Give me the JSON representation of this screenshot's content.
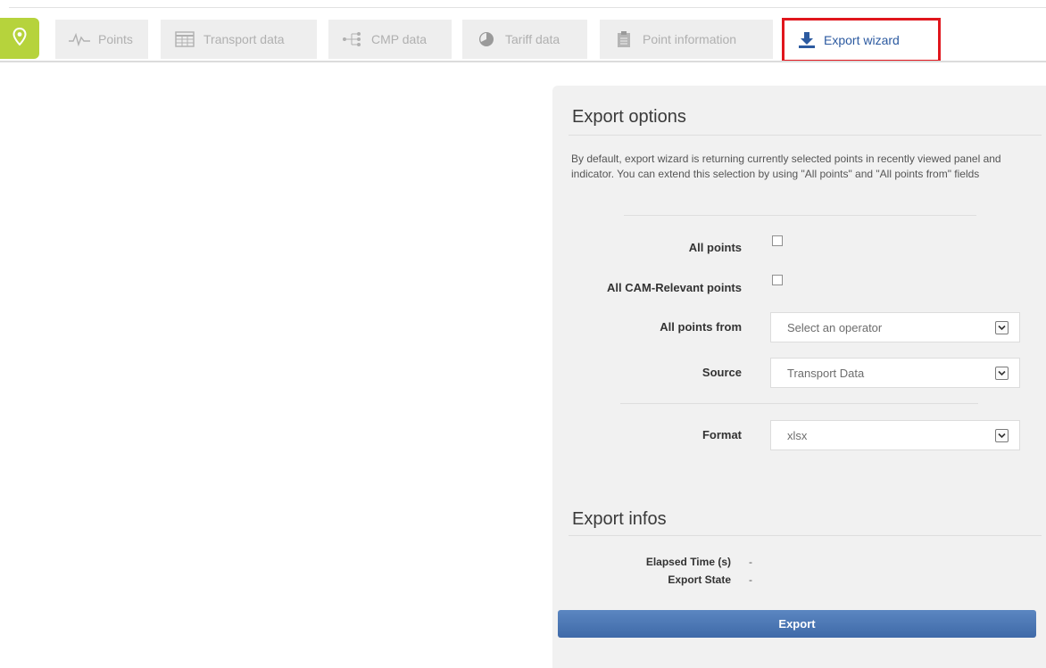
{
  "tabs": [
    {
      "name": "points",
      "label": "Points",
      "icon": "pulse-icon",
      "active": false
    },
    {
      "name": "transport-data",
      "label": "Transport data",
      "icon": "table-icon",
      "active": false
    },
    {
      "name": "cmp-data",
      "label": "CMP data",
      "icon": "network-icon",
      "active": false
    },
    {
      "name": "tariff-data",
      "label": "Tariff data",
      "icon": "pie-icon",
      "active": false
    },
    {
      "name": "point-information",
      "label": "Point information",
      "icon": "clipboard-icon",
      "active": false
    },
    {
      "name": "export-wizard",
      "label": "Export wizard",
      "icon": "download-icon",
      "active": true
    }
  ],
  "colors": {
    "accent": "#b6d33c",
    "highlight": "#e0161d",
    "active_tab_text": "#2c5aa0",
    "button": "#4a74b2"
  },
  "options": {
    "title": "Export options",
    "description": "By default, export wizard is returning currently selected points in recently viewed panel and indicator. You can extend this selection by using \"All points\" and \"All points from\" fields",
    "all_points_label": "All points",
    "cam_relevant_label": "All CAM-Relevant points",
    "all_points_from_label": "All points from",
    "all_points_from_value": "Select an operator",
    "source_label": "Source",
    "source_value": "Transport Data",
    "format_label": "Format",
    "format_value": "xlsx"
  },
  "infos": {
    "title": "Export infos",
    "elapsed_label": "Elapsed Time (s)",
    "elapsed_value": "-",
    "state_label": "Export State",
    "state_value": "-"
  },
  "export_button": "Export"
}
